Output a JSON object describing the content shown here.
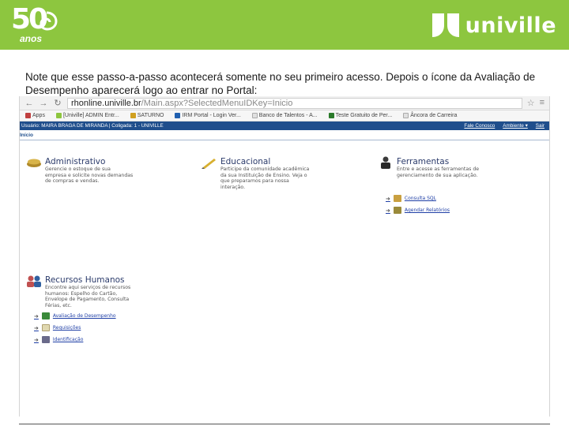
{
  "header": {
    "anniversary_number": "50",
    "anniversary_text": "anos",
    "brand": "univille",
    "colors": {
      "bar": "#8dc63f",
      "logo": "#ffffff"
    }
  },
  "intro_text": "Note que esse passo-a-passo acontecerá somente no seu primeiro acesso. Depois o ícone da Avaliação de Desempenho aparecerá logo ao entrar no Portal:",
  "browser": {
    "url_host": "rhonline.univille.br",
    "url_path": "/Main.aspx?SelectedMenuIDKey=Inicio",
    "bookmarks": [
      {
        "label": "Apps",
        "icon": "apps-grid-icon",
        "color": "#c04040"
      },
      {
        "label": "[Univille] ADMIN Entr...",
        "icon": "univille-icon",
        "color": "#8dc63f"
      },
      {
        "label": "SATURNO",
        "icon": "saturn-icon",
        "color": "#d0a020"
      },
      {
        "label": "IRM Portal - Login Ver...",
        "icon": "irm-icon",
        "color": "#2060b0"
      },
      {
        "label": "Banco de Talentos - A...",
        "icon": "document-icon",
        "color": "#e0e0e0"
      },
      {
        "label": "Teste Gratuito de Per...",
        "icon": "test-icon",
        "color": "#2a7a2a"
      },
      {
        "label": "Âncora de Carreira",
        "icon": "document-icon",
        "color": "#e0e0e0"
      }
    ]
  },
  "portal": {
    "user_line": "Usuário: MAIRA BRAGA DE MIRANDA  |  Coligada: 1 - UNIVILLE",
    "fale_conosco": "Fale Conosco",
    "ambiente": "Ambiente ▾",
    "sair": "Sair",
    "breadcrumb": "Início",
    "modules": {
      "administrativo": {
        "title": "Administrativo",
        "description": "Gerencie o estoque de sua\nempresa e solicite novas demandas\nde compras e vendas."
      },
      "educacional": {
        "title": "Educacional",
        "description": "Participe da comunidade acadêmica\nda sua Instituição de Ensino. Veja o\nque preparamos para nossa\ninteração."
      },
      "ferramentas": {
        "title": "Ferramentas",
        "description": "Entre e acesse as ferramentas de\ngerenciamento de sua aplicação.",
        "links": [
          "Consulta SQL",
          "Agendar Relatórios"
        ]
      },
      "rh": {
        "title": "Recursos Humanos",
        "description": "Encontre aqui serviços de recursos\nhumanos: Espelho do Cartão,\nEnvelope de Pagamento, Consulta\nFérias, etc.",
        "links": [
          "Avaliação de Desempenho",
          "Requisições",
          "Identificação"
        ]
      }
    }
  }
}
